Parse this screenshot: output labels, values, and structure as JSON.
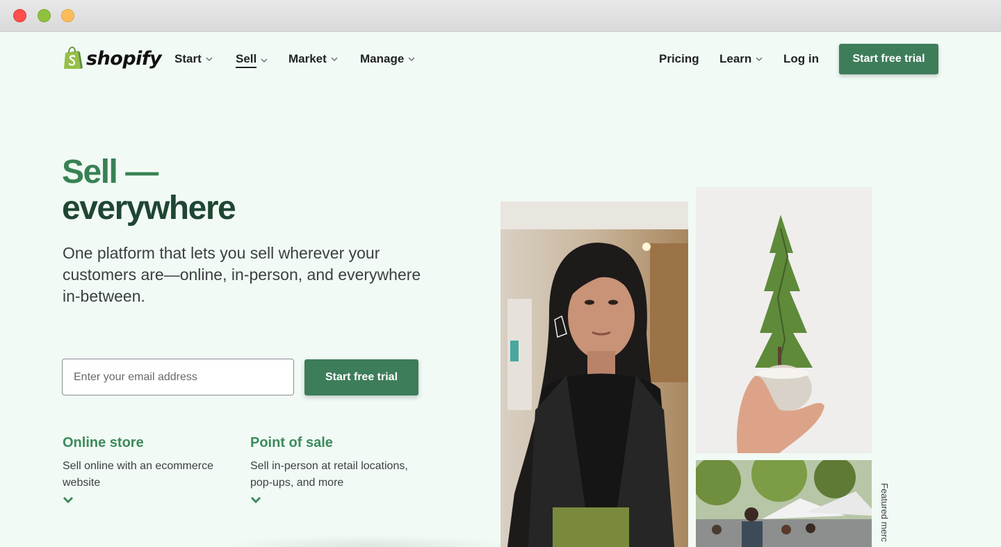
{
  "window": {
    "controls": [
      "close",
      "minimize",
      "zoom"
    ]
  },
  "brand": {
    "name": "shopify",
    "logo_icon": "shopping-bag-logo-icon",
    "accent": "#3d7d5a",
    "green_light": "#378154",
    "green_dark": "#1f4633"
  },
  "nav": {
    "left": [
      {
        "label": "Start",
        "icon": "chevron-down-icon",
        "active": false
      },
      {
        "label": "Sell",
        "icon": "chevron-down-icon",
        "active": true
      },
      {
        "label": "Market",
        "icon": "chevron-down-icon",
        "active": false
      },
      {
        "label": "Manage",
        "icon": "chevron-down-icon",
        "active": false
      }
    ],
    "right": {
      "pricing": "Pricing",
      "learn": "Learn",
      "login": "Log in",
      "cta": "Start free trial"
    }
  },
  "hero": {
    "title_line1": "Sell —",
    "title_line2": "everywhere",
    "subtitle": "One platform that lets you sell wherever your customers are—online, in-person, and everywhere in-between.",
    "email_placeholder": "Enter your email address",
    "cta": "Start free trial"
  },
  "features": [
    {
      "title": "Online store",
      "description": "Sell online with an ecommerce website",
      "icon": "chevron-down-icon"
    },
    {
      "title": "Point of sale",
      "description": "Sell in-person at retail locations, pop-ups, and more",
      "icon": "chevron-down-icon"
    }
  ],
  "images": {
    "caption": "Featured merc"
  }
}
